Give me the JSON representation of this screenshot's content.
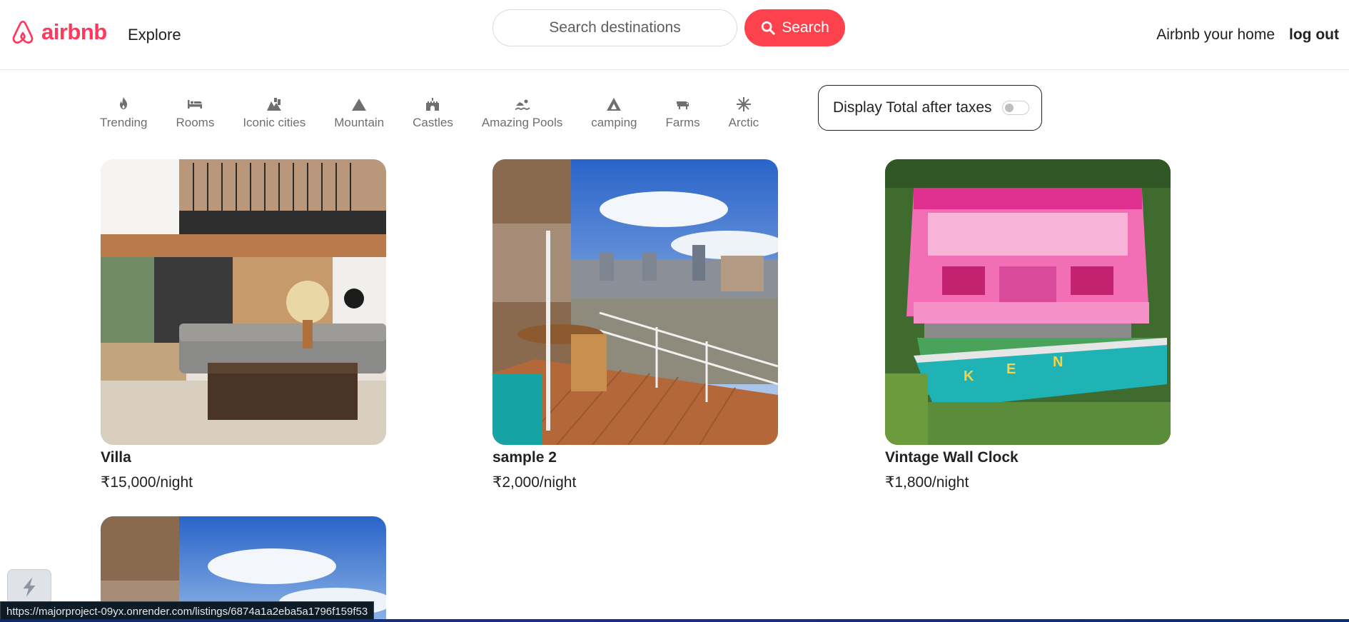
{
  "navbar": {
    "brand": "airbnb",
    "explore": "Explore",
    "search_placeholder": "Search destinations",
    "search_button": "Search",
    "host_link": "Airbnb your home",
    "logout": "log out"
  },
  "filters": [
    {
      "label": "Trending",
      "icon": "fire-icon"
    },
    {
      "label": "Rooms",
      "icon": "bed-icon"
    },
    {
      "label": "Iconic cities",
      "icon": "city-icon"
    },
    {
      "label": "Mountain",
      "icon": "mountain-icon"
    },
    {
      "label": "Castles",
      "icon": "castle-icon"
    },
    {
      "label": "Amazing Pools",
      "icon": "swimmer-icon"
    },
    {
      "label": "camping",
      "icon": "tent-icon"
    },
    {
      "label": "Farms",
      "icon": "cow-icon"
    },
    {
      "label": "Arctic",
      "icon": "snowflake-icon"
    }
  ],
  "tax_toggle": {
    "label": "Display Total after taxes",
    "enabled": false
  },
  "listings": [
    {
      "title": "Villa",
      "price": "₹15,000/night"
    },
    {
      "title": "sample 2",
      "price": "₹2,000/night"
    },
    {
      "title": "Vintage Wall Clock",
      "price": "₹1,800/night"
    },
    {
      "title": "",
      "price": ""
    }
  ],
  "status_url": "https://majorproject-09yx.onrender.com/listings/6874a1a2eba5a1796f159f53",
  "colors": {
    "brand": "#ff385c",
    "search_button": "#fe424d",
    "muted": "#6f6f6f"
  }
}
